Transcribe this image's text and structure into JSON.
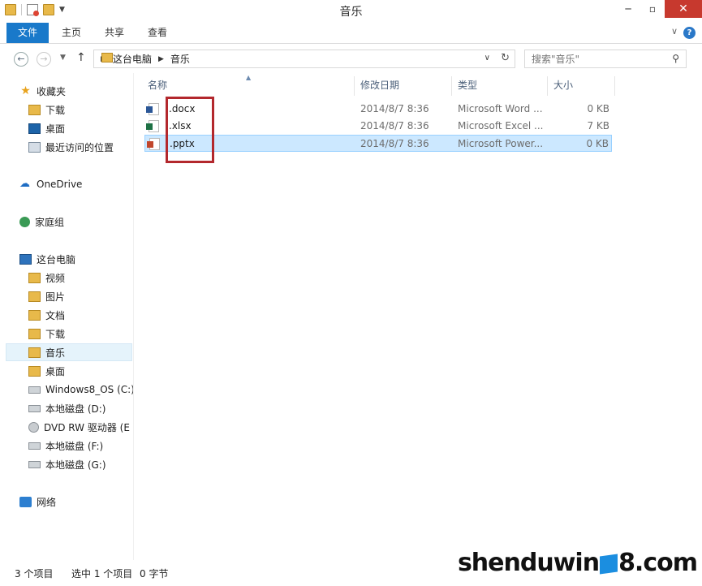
{
  "window": {
    "title": "音乐"
  },
  "ribbon": {
    "tabs": [
      "文件",
      "主页",
      "共享",
      "查看"
    ]
  },
  "address": {
    "crumbs": [
      "这台电脑",
      "音乐"
    ],
    "search_placeholder": "搜索\"音乐\""
  },
  "columns": {
    "name": "名称",
    "date": "修改日期",
    "type": "类型",
    "size": "大小"
  },
  "files": [
    {
      "name": ".docx",
      "date": "2014/8/7 8:36",
      "type": "Microsoft Word ...",
      "size": "0 KB",
      "icon": "word-icon"
    },
    {
      "name": ".xlsx",
      "date": "2014/8/7 8:36",
      "type": "Microsoft Excel ...",
      "size": "7 KB",
      "icon": "excel-icon"
    },
    {
      "name": ".pptx",
      "date": "2014/8/7 8:36",
      "type": "Microsoft Power...",
      "size": "0 KB",
      "icon": "powerpoint-icon",
      "selected": true
    }
  ],
  "nav": {
    "favorites": "收藏夹",
    "fav_items": [
      "下载",
      "桌面",
      "最近访问的位置"
    ],
    "onedrive": "OneDrive",
    "homegroup": "家庭组",
    "thispc": "这台电脑",
    "pc_items": [
      "视频",
      "图片",
      "文档",
      "下载",
      "音乐",
      "桌面",
      "Windows8_OS (C:)",
      "本地磁盘 (D:)",
      "DVD RW 驱动器 (E",
      "本地磁盘 (F:)",
      "本地磁盘 (G:)"
    ],
    "network": "网络"
  },
  "status": {
    "count": "3 个项目",
    "selection": "选中 1 个项目",
    "bytes": "0 字节"
  },
  "watermark": {
    "left": "shenduwin",
    "right": "8.com"
  },
  "colors": {
    "accent": "#1979ca",
    "highlight": "#b3282d",
    "selection": "#cce8ff"
  }
}
